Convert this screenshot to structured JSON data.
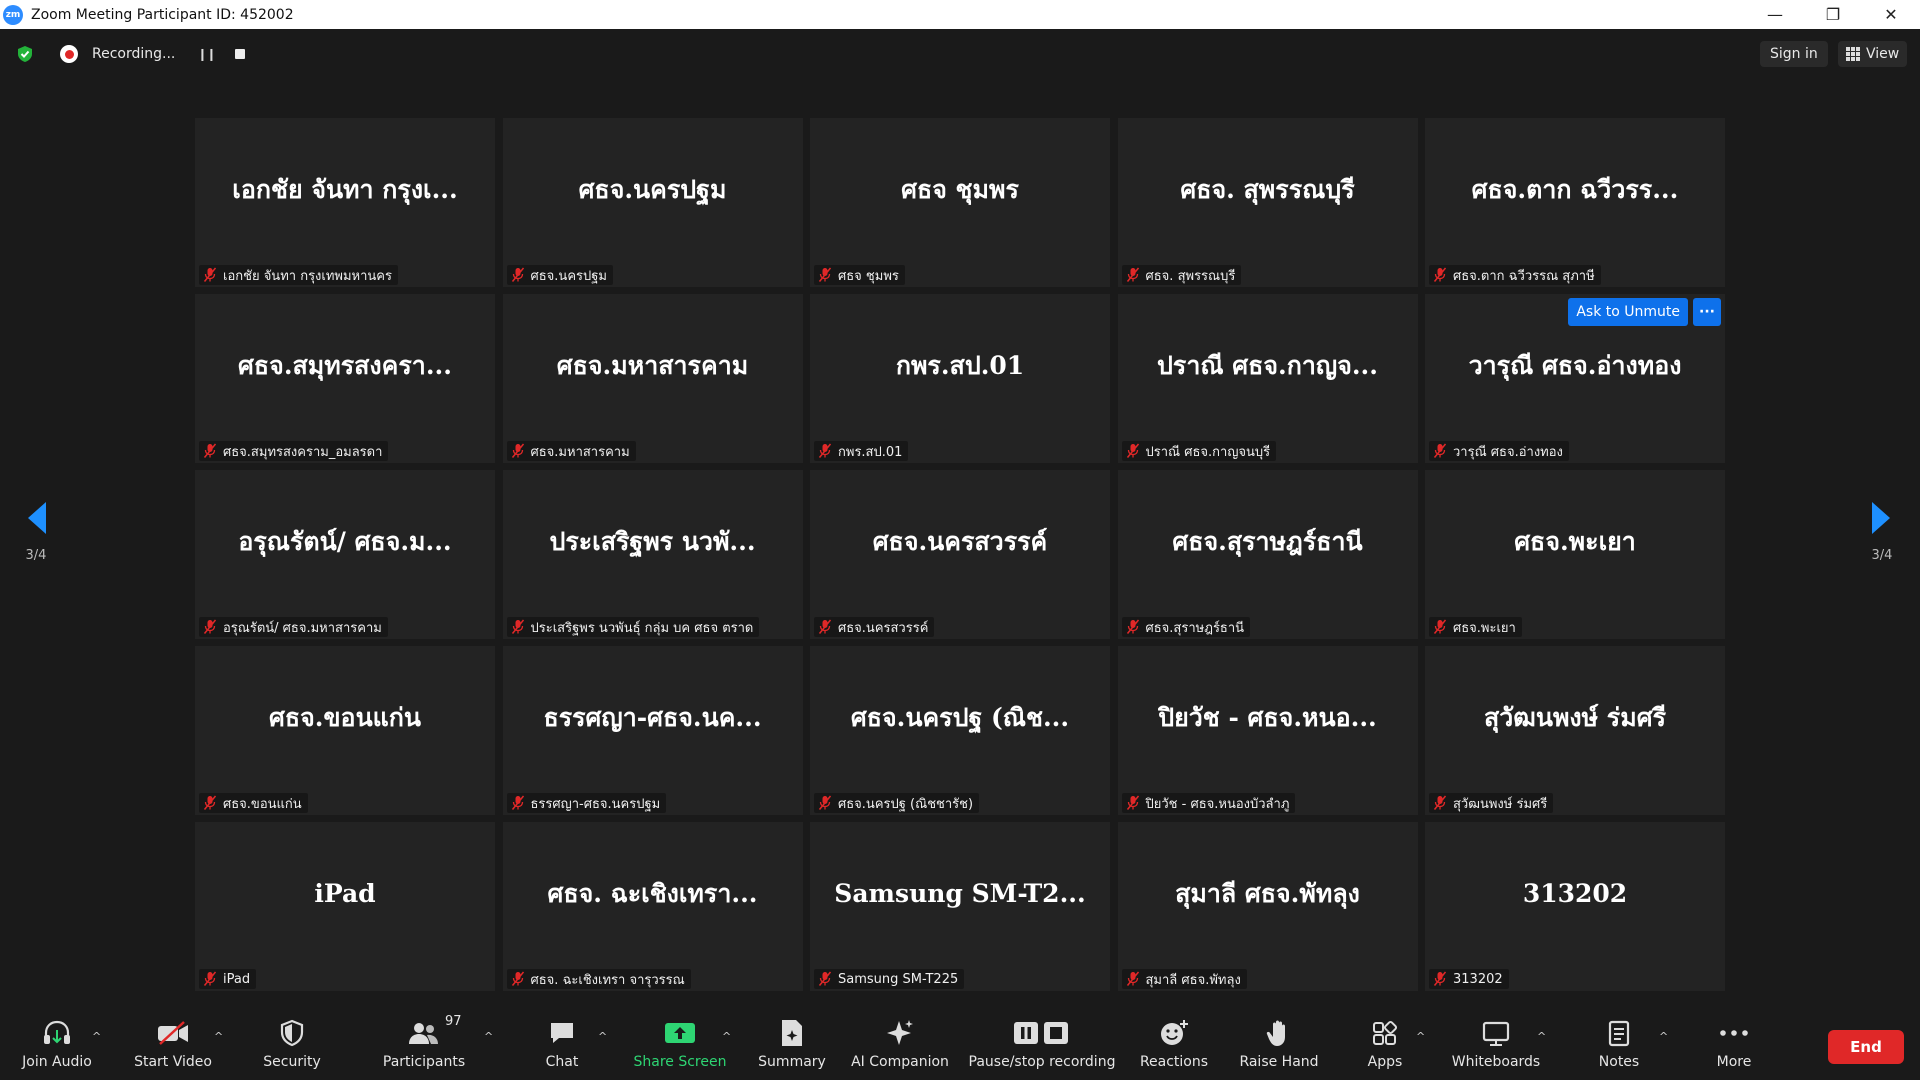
{
  "window": {
    "title": "Zoom Meeting Participant ID: 452002",
    "logo_text": "zm",
    "minimize": "—",
    "restore": "❐",
    "close": "✕"
  },
  "topbar": {
    "recording_text": "Recording...",
    "signin_label": "Sign in",
    "view_label": "View"
  },
  "pagination": {
    "prev_label": "3/4",
    "next_label": "3/4"
  },
  "tile_actions": {
    "ask_unmute": "Ask to Unmute",
    "more": "···"
  },
  "participants": [
    {
      "display": "เอกชัย จันทา กรุงเ...",
      "label": "เอกชัย จันทา กรุงเทพมหานคร"
    },
    {
      "display": "ศธจ.นครปฐม",
      "label": "ศธจ.นครปฐม"
    },
    {
      "display": "ศธจ ชุมพร",
      "label": "ศธจ ชุมพร"
    },
    {
      "display": "ศธจ. สุพรรณบุรี",
      "label": "ศธจ. สุพรรณบุรี"
    },
    {
      "display": "ศธจ.ตาก ฉวีวรร...",
      "label": "ศธจ.ตาก ฉวีวรรณ สุภาษี"
    },
    {
      "display": "ศธจ.สมุทรสงครา...",
      "label": "ศธจ.สมุทรสงคราม_อมลรดา"
    },
    {
      "display": "ศธจ.มหาสารคาม",
      "label": "ศธจ.มหาสารคาม"
    },
    {
      "display": "กพร.สป.01",
      "label": "กพร.สป.01"
    },
    {
      "display": "ปราณี ศธจ.กาญจ...",
      "label": "ปราณี ศธจ.กาญจนบุรี"
    },
    {
      "display": "วารุณี ศธจ.อ่างทอง",
      "label": "วารุณี ศธจ.อ่างทอง",
      "hover": true
    },
    {
      "display": "อรุณรัตน์/ ศธจ.ม...",
      "label": "อรุณรัตน์/ ศธจ.มหาสารคาม"
    },
    {
      "display": "ประเสริฐพร นวพั...",
      "label": "ประเสริฐพร นวพันธุ์ กลุ่ม บค ศธจ ตราด"
    },
    {
      "display": "ศธจ.นครสวรรค์",
      "label": "ศธจ.นครสวรรค์"
    },
    {
      "display": "ศธจ.สุราษฎร์ธานี",
      "label": "ศธจ.สุราษฎร์ธานี"
    },
    {
      "display": "ศธจ.พะเยา",
      "label": "ศธจ.พะเยา"
    },
    {
      "display": "ศธจ.ขอนแก่น",
      "label": "ศธจ.ขอนแก่น"
    },
    {
      "display": "ธรรศญา-ศธจ.นค...",
      "label": "ธรรศญา-ศธจ.นครปฐม"
    },
    {
      "display": "ศธจ.นครปฐ (ณิช...",
      "label": "ศธจ.นครปฐ (ณิชชารัช)"
    },
    {
      "display": "ปิยวัช - ศธจ.หนอ...",
      "label": "ปิยวัช - ศธจ.หนองบัวลำภู"
    },
    {
      "display": "สุวัฒนพงษ์ ร่มศรี",
      "label": "สุวัฒนพงษ์ ร่มศรี"
    },
    {
      "display": "iPad",
      "label": "iPad"
    },
    {
      "display": "ศธจ. ฉะเชิงเทรา...",
      "label": "ศธจ. ฉะเชิงเทรา จารุวรรณ"
    },
    {
      "display": "Samsung  SM-T2...",
      "label": "Samsung SM-T225"
    },
    {
      "display": "สุมาลี ศธจ.พัทลุง",
      "label": "สุมาลี ศธจ.พัทลุง"
    },
    {
      "display": "313202",
      "label": "313202"
    }
  ],
  "toolbar": {
    "join_audio": "Join Audio",
    "start_video": "Start Video",
    "security": "Security",
    "participants": "Participants",
    "participants_count": "97",
    "chat": "Chat",
    "share_screen": "Share Screen",
    "summary": "Summary",
    "ai_companion": "AI Companion",
    "pause_stop_recording": "Pause/stop recording",
    "reactions": "Reactions",
    "raise_hand": "Raise Hand",
    "apps": "Apps",
    "whiteboards": "Whiteboards",
    "notes": "Notes",
    "more": "More",
    "end": "End",
    "caret": "^"
  },
  "colors": {
    "accent": "#0e71eb",
    "end": "#e02828",
    "share_green": "#2ed573",
    "mute_red": "#e02828",
    "arrow_blue": "#1e90ff"
  }
}
